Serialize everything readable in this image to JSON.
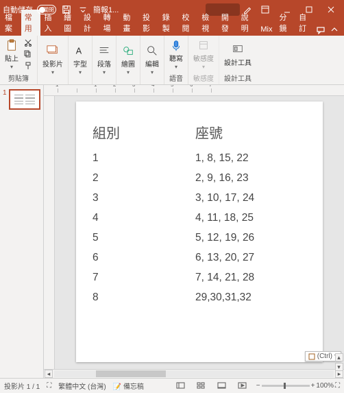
{
  "titlebar": {
    "autosave_label": "自動儲存",
    "autosave_state": "關閉",
    "doc_title": "簡報1..."
  },
  "tabs": {
    "items": [
      "檔案",
      "常用",
      "插入",
      "繪圖",
      "設計",
      "轉場",
      "動畫",
      "投影",
      "錄製",
      "校閱",
      "檢視",
      "開發",
      "說明",
      "Mix",
      "分鏡",
      "自訂"
    ],
    "active_index": 1
  },
  "ribbon": {
    "clipboard": {
      "paste": "貼上",
      "group": "剪貼簿"
    },
    "slides": {
      "btn": "投影片",
      "group": ""
    },
    "font": {
      "btn": "字型",
      "group": ""
    },
    "para": {
      "btn": "段落",
      "group": ""
    },
    "draw": {
      "btn": "繪圖",
      "group": ""
    },
    "edit": {
      "btn": "編輯",
      "group": ""
    },
    "voice": {
      "btn": "聽寫",
      "group": "語音"
    },
    "sens": {
      "btn": "敏感度",
      "group": "敏感度"
    },
    "designer": {
      "btn": "設計工具",
      "group": "設計工具"
    }
  },
  "ruler": {
    "h": [
      "1",
      "",
      "1",
      "2",
      "3",
      "4",
      "5",
      "6",
      "7"
    ]
  },
  "thumbs": {
    "items": [
      {
        "num": "1"
      }
    ]
  },
  "slide": {
    "headers": [
      "組別",
      "座號"
    ],
    "rows": [
      [
        "1",
        "1, 8, 15, 22"
      ],
      [
        "2",
        "2, 9, 16, 23"
      ],
      [
        "3",
        "3, 10, 17, 24"
      ],
      [
        "4",
        "4, 11, 18, 25"
      ],
      [
        "5",
        "5, 12, 19, 26"
      ],
      [
        "6",
        "6, 13, 20, 27"
      ],
      [
        "7",
        "7, 14, 21, 28"
      ],
      [
        "8",
        "29,30,31,32"
      ]
    ]
  },
  "paste_options": {
    "label": "(Ctrl)"
  },
  "status": {
    "slide_counter": "投影片 1 / 1",
    "lang": "繁體中文 (台灣)",
    "notes": "備忘稿",
    "zoom": "100%"
  }
}
